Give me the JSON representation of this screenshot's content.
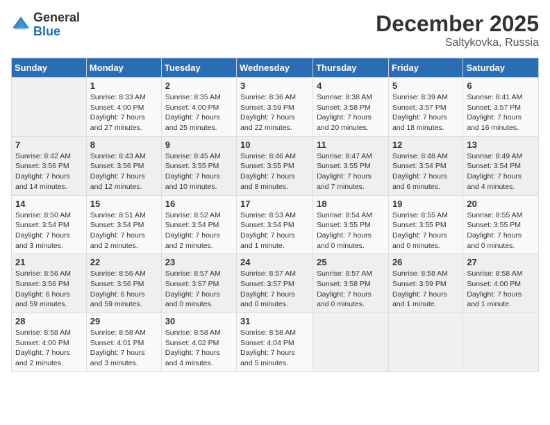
{
  "header": {
    "logo_general": "General",
    "logo_blue": "Blue",
    "month": "December 2025",
    "location": "Saltykovka, Russia"
  },
  "weekdays": [
    "Sunday",
    "Monday",
    "Tuesday",
    "Wednesday",
    "Thursday",
    "Friday",
    "Saturday"
  ],
  "weeks": [
    [
      {
        "day": "",
        "info": ""
      },
      {
        "day": "1",
        "info": "Sunrise: 8:33 AM\nSunset: 4:00 PM\nDaylight: 7 hours\nand 27 minutes."
      },
      {
        "day": "2",
        "info": "Sunrise: 8:35 AM\nSunset: 4:00 PM\nDaylight: 7 hours\nand 25 minutes."
      },
      {
        "day": "3",
        "info": "Sunrise: 8:36 AM\nSunset: 3:59 PM\nDaylight: 7 hours\nand 22 minutes."
      },
      {
        "day": "4",
        "info": "Sunrise: 8:38 AM\nSunset: 3:58 PM\nDaylight: 7 hours\nand 20 minutes."
      },
      {
        "day": "5",
        "info": "Sunrise: 8:39 AM\nSunset: 3:57 PM\nDaylight: 7 hours\nand 18 minutes."
      },
      {
        "day": "6",
        "info": "Sunrise: 8:41 AM\nSunset: 3:57 PM\nDaylight: 7 hours\nand 16 minutes."
      }
    ],
    [
      {
        "day": "7",
        "info": "Sunrise: 8:42 AM\nSunset: 3:56 PM\nDaylight: 7 hours\nand 14 minutes."
      },
      {
        "day": "8",
        "info": "Sunrise: 8:43 AM\nSunset: 3:56 PM\nDaylight: 7 hours\nand 12 minutes."
      },
      {
        "day": "9",
        "info": "Sunrise: 8:45 AM\nSunset: 3:55 PM\nDaylight: 7 hours\nand 10 minutes."
      },
      {
        "day": "10",
        "info": "Sunrise: 8:46 AM\nSunset: 3:55 PM\nDaylight: 7 hours\nand 8 minutes."
      },
      {
        "day": "11",
        "info": "Sunrise: 8:47 AM\nSunset: 3:55 PM\nDaylight: 7 hours\nand 7 minutes."
      },
      {
        "day": "12",
        "info": "Sunrise: 8:48 AM\nSunset: 3:54 PM\nDaylight: 7 hours\nand 6 minutes."
      },
      {
        "day": "13",
        "info": "Sunrise: 8:49 AM\nSunset: 3:54 PM\nDaylight: 7 hours\nand 4 minutes."
      }
    ],
    [
      {
        "day": "14",
        "info": "Sunrise: 8:50 AM\nSunset: 3:54 PM\nDaylight: 7 hours\nand 3 minutes."
      },
      {
        "day": "15",
        "info": "Sunrise: 8:51 AM\nSunset: 3:54 PM\nDaylight: 7 hours\nand 2 minutes."
      },
      {
        "day": "16",
        "info": "Sunrise: 8:52 AM\nSunset: 3:54 PM\nDaylight: 7 hours\nand 2 minutes."
      },
      {
        "day": "17",
        "info": "Sunrise: 8:53 AM\nSunset: 3:54 PM\nDaylight: 7 hours\nand 1 minute."
      },
      {
        "day": "18",
        "info": "Sunrise: 8:54 AM\nSunset: 3:55 PM\nDaylight: 7 hours\nand 0 minutes."
      },
      {
        "day": "19",
        "info": "Sunrise: 8:55 AM\nSunset: 3:55 PM\nDaylight: 7 hours\nand 0 minutes."
      },
      {
        "day": "20",
        "info": "Sunrise: 8:55 AM\nSunset: 3:55 PM\nDaylight: 7 hours\nand 0 minutes."
      }
    ],
    [
      {
        "day": "21",
        "info": "Sunrise: 8:56 AM\nSunset: 3:56 PM\nDaylight: 6 hours\nand 59 minutes."
      },
      {
        "day": "22",
        "info": "Sunrise: 8:56 AM\nSunset: 3:56 PM\nDaylight: 6 hours\nand 59 minutes."
      },
      {
        "day": "23",
        "info": "Sunrise: 8:57 AM\nSunset: 3:57 PM\nDaylight: 7 hours\nand 0 minutes."
      },
      {
        "day": "24",
        "info": "Sunrise: 8:57 AM\nSunset: 3:57 PM\nDaylight: 7 hours\nand 0 minutes."
      },
      {
        "day": "25",
        "info": "Sunrise: 8:57 AM\nSunset: 3:58 PM\nDaylight: 7 hours\nand 0 minutes."
      },
      {
        "day": "26",
        "info": "Sunrise: 8:58 AM\nSunset: 3:59 PM\nDaylight: 7 hours\nand 1 minute."
      },
      {
        "day": "27",
        "info": "Sunrise: 8:58 AM\nSunset: 4:00 PM\nDaylight: 7 hours\nand 1 minute."
      }
    ],
    [
      {
        "day": "28",
        "info": "Sunrise: 8:58 AM\nSunset: 4:00 PM\nDaylight: 7 hours\nand 2 minutes."
      },
      {
        "day": "29",
        "info": "Sunrise: 8:58 AM\nSunset: 4:01 PM\nDaylight: 7 hours\nand 3 minutes."
      },
      {
        "day": "30",
        "info": "Sunrise: 8:58 AM\nSunset: 4:02 PM\nDaylight: 7 hours\nand 4 minutes."
      },
      {
        "day": "31",
        "info": "Sunrise: 8:58 AM\nSunset: 4:04 PM\nDaylight: 7 hours\nand 5 minutes."
      },
      {
        "day": "",
        "info": ""
      },
      {
        "day": "",
        "info": ""
      },
      {
        "day": "",
        "info": ""
      }
    ]
  ]
}
